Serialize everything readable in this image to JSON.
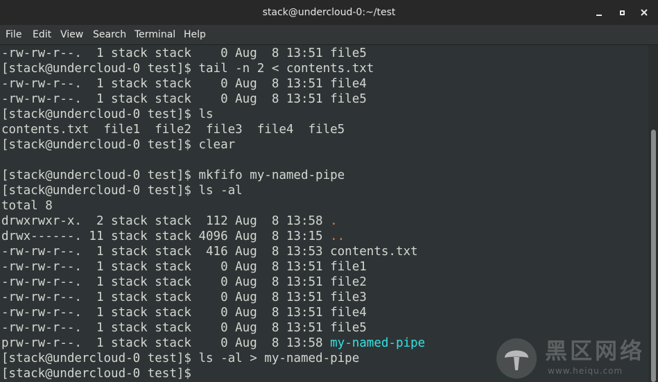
{
  "window": {
    "title": "stack@undercloud-0:~/test"
  },
  "menubar": {
    "items": [
      "File",
      "Edit",
      "View",
      "Search",
      "Terminal",
      "Help"
    ]
  },
  "terminal": {
    "lines": [
      [
        {
          "text": "-rw-rw-r--.  1 stack stack    0 Aug  8 13:51 file5"
        }
      ],
      [
        {
          "text": "[stack@undercloud-0 test]$ tail -n 2 < contents.txt"
        }
      ],
      [
        {
          "text": "-rw-rw-r--.  1 stack stack    0 Aug  8 13:51 file4"
        }
      ],
      [
        {
          "text": "-rw-rw-r--.  1 stack stack    0 Aug  8 13:51 file5"
        }
      ],
      [
        {
          "text": "[stack@undercloud-0 test]$ ls"
        }
      ],
      [
        {
          "text": "contents.txt  file1  file2  file3  file4  file5"
        }
      ],
      [
        {
          "text": "[stack@undercloud-0 test]$ clear"
        }
      ],
      [
        {
          "text": ""
        }
      ],
      [
        {
          "text": "[stack@undercloud-0 test]$ mkfifo my-named-pipe"
        }
      ],
      [
        {
          "text": "[stack@undercloud-0 test]$ ls -al"
        }
      ],
      [
        {
          "text": "total 8"
        }
      ],
      [
        {
          "text": "drwxrwxr-x.  2 stack stack  112 Aug  8 13:58 "
        },
        {
          "text": ".",
          "color": "orange"
        }
      ],
      [
        {
          "text": "drwx------. 11 stack stack 4096 Aug  8 13:15 "
        },
        {
          "text": "..",
          "color": "orange"
        }
      ],
      [
        {
          "text": "-rw-rw-r--.  1 stack stack  416 Aug  8 13:53 contents.txt"
        }
      ],
      [
        {
          "text": "-rw-rw-r--.  1 stack stack    0 Aug  8 13:51 file1"
        }
      ],
      [
        {
          "text": "-rw-rw-r--.  1 stack stack    0 Aug  8 13:51 file2"
        }
      ],
      [
        {
          "text": "-rw-rw-r--.  1 stack stack    0 Aug  8 13:51 file3"
        }
      ],
      [
        {
          "text": "-rw-rw-r--.  1 stack stack    0 Aug  8 13:51 file4"
        }
      ],
      [
        {
          "text": "-rw-rw-r--.  1 stack stack    0 Aug  8 13:51 file5"
        }
      ],
      [
        {
          "text": "prw-rw-r--.  1 stack stack    0 Aug  8 13:58 "
        },
        {
          "text": "my-named-pipe",
          "color": "cyan"
        }
      ],
      [
        {
          "text": "[stack@undercloud-0 test]$ ls -al > my-named-pipe"
        }
      ],
      [
        {
          "text": "[stack@undercloud-0 test]$ "
        }
      ]
    ]
  },
  "colors": {
    "background": "#2e3436",
    "foreground": "#d3d7cf",
    "orange": "#e07b39",
    "cyan": "#34e2e2",
    "titlebar": "#282828"
  },
  "watermark": {
    "logo_text": "黑区网络",
    "url": "www.heiqu.com"
  }
}
